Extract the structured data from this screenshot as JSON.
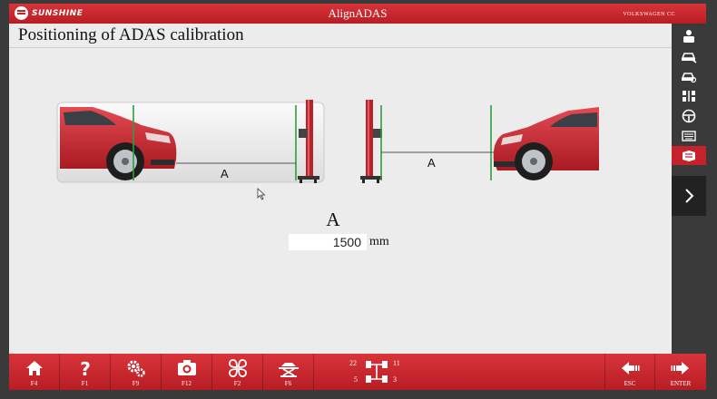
{
  "titlebar": {
    "brand": "SUNSHINE",
    "title": "AlignADAS",
    "vehicle": "VOLKSWAGEN CC"
  },
  "main": {
    "page_title": "Positioning of ADAS calibration",
    "diagram": {
      "left_label": "A",
      "right_label": "A"
    },
    "distance": {
      "label": "A",
      "value": "1500",
      "unit": "mm"
    }
  },
  "sidebar": {
    "items": [
      {
        "icon": "technician-icon"
      },
      {
        "icon": "car-wrench-icon"
      },
      {
        "icon": "car-search-icon"
      },
      {
        "icon": "axle-adjust-icon"
      },
      {
        "icon": "steering-wheel-icon"
      },
      {
        "icon": "keyboard-icon"
      },
      {
        "icon": "adas-calibration-icon",
        "active": true
      }
    ],
    "next_icon": "chevron-right-icon"
  },
  "toolbar": {
    "home_key": "F4",
    "help_key": "F1",
    "settings_key": "F9",
    "camera_key": "F12",
    "menu_key": "F2",
    "lift_key": "F6",
    "esc_key": "ESC",
    "enter_key": "ENTER",
    "axle": {
      "tl": "22",
      "tr": "11",
      "bl": "5",
      "br": "3"
    }
  },
  "colors": {
    "accent": "#c4232b",
    "guide_line": "#2e9e3c",
    "car_body": "#d8323c"
  }
}
